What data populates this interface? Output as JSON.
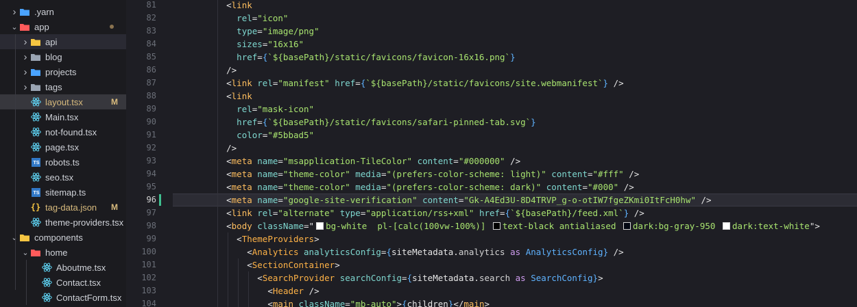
{
  "explorer": {
    "items": [
      {
        "label": ".yarn",
        "kind": "folder",
        "depth": 1,
        "expanded": false,
        "icon": "folder-yarn-icon",
        "color": "#4aa3ff"
      },
      {
        "label": "app",
        "kind": "folder",
        "depth": 1,
        "expanded": true,
        "icon": "folder-app-icon",
        "color": "#ff5b5b",
        "has_dot": true
      },
      {
        "label": "api",
        "kind": "folder",
        "depth": 2,
        "expanded": false,
        "icon": "folder-api-icon",
        "color": "#f5c542",
        "selected": true
      },
      {
        "label": "blog",
        "kind": "folder",
        "depth": 2,
        "expanded": false,
        "icon": "folder-icon",
        "color": "#9aa4b2"
      },
      {
        "label": "projects",
        "kind": "folder",
        "depth": 2,
        "expanded": false,
        "icon": "folder-projects-icon",
        "color": "#4aa3ff"
      },
      {
        "label": "tags",
        "kind": "folder",
        "depth": 2,
        "expanded": false,
        "icon": "folder-icon",
        "color": "#9aa4b2"
      },
      {
        "label": "layout.tsx",
        "kind": "file",
        "depth": 2,
        "icon": "react-icon",
        "color": "#61dafb",
        "active": true,
        "badge": "M"
      },
      {
        "label": "Main.tsx",
        "kind": "file",
        "depth": 2,
        "icon": "react-icon",
        "color": "#61dafb"
      },
      {
        "label": "not-found.tsx",
        "kind": "file",
        "depth": 2,
        "icon": "react-icon",
        "color": "#61dafb"
      },
      {
        "label": "page.tsx",
        "kind": "file",
        "depth": 2,
        "icon": "react-icon",
        "color": "#61dafb"
      },
      {
        "label": "robots.ts",
        "kind": "file",
        "depth": 2,
        "icon": "typescript-icon",
        "color": "#3178c6"
      },
      {
        "label": "seo.tsx",
        "kind": "file",
        "depth": 2,
        "icon": "react-icon",
        "color": "#61dafb"
      },
      {
        "label": "sitemap.ts",
        "kind": "file",
        "depth": 2,
        "icon": "typescript-icon",
        "color": "#3178c6"
      },
      {
        "label": "tag-data.json",
        "kind": "file",
        "depth": 2,
        "icon": "json-icon",
        "color": "#f5c542",
        "badge": "M"
      },
      {
        "label": "theme-providers.tsx",
        "kind": "file",
        "depth": 2,
        "icon": "react-icon",
        "color": "#61dafb"
      },
      {
        "label": "components",
        "kind": "folder",
        "depth": 1,
        "expanded": true,
        "icon": "folder-components-icon",
        "color": "#f5c542"
      },
      {
        "label": "home",
        "kind": "folder",
        "depth": 2,
        "expanded": true,
        "icon": "folder-home-icon",
        "color": "#ff5b5b"
      },
      {
        "label": "Aboutme.tsx",
        "kind": "file",
        "depth": 3,
        "icon": "react-icon",
        "color": "#61dafb"
      },
      {
        "label": "Contact.tsx",
        "kind": "file",
        "depth": 3,
        "icon": "react-icon",
        "color": "#61dafb"
      },
      {
        "label": "ContactForm.tsx",
        "kind": "file",
        "depth": 3,
        "icon": "react-icon",
        "color": "#61dafb"
      }
    ]
  },
  "editor": {
    "current_line": 96,
    "modified_line": 96,
    "lines": [
      {
        "n": "81",
        "indent": 4,
        "tokens": [
          [
            "t-punc",
            "<"
          ],
          [
            "t-tag",
            "link"
          ]
        ]
      },
      {
        "n": "82",
        "indent": 6,
        "tokens": [
          [
            "t-attr",
            "rel"
          ],
          [
            "t-punc",
            "="
          ],
          [
            "t-str",
            "\"icon\""
          ]
        ]
      },
      {
        "n": "83",
        "indent": 6,
        "tokens": [
          [
            "t-attr",
            "type"
          ],
          [
            "t-punc",
            "="
          ],
          [
            "t-str",
            "\"image/png\""
          ]
        ]
      },
      {
        "n": "84",
        "indent": 6,
        "tokens": [
          [
            "t-attr",
            "sizes"
          ],
          [
            "t-punc",
            "="
          ],
          [
            "t-str",
            "\"16x16\""
          ]
        ]
      },
      {
        "n": "85",
        "indent": 6,
        "tokens": [
          [
            "t-attr",
            "href"
          ],
          [
            "t-punc",
            "="
          ],
          [
            "t-br",
            "{"
          ],
          [
            "t-str",
            "`${basePath}/static/favicons/favicon-16x16.png`"
          ],
          [
            "t-br",
            "}"
          ]
        ]
      },
      {
        "n": "86",
        "indent": 4,
        "tokens": [
          [
            "t-punc",
            "/>"
          ]
        ]
      },
      {
        "n": "87",
        "indent": 4,
        "tokens": [
          [
            "t-punc",
            "<"
          ],
          [
            "t-tag",
            "link"
          ],
          [
            "t-plain",
            " "
          ],
          [
            "t-attr",
            "rel"
          ],
          [
            "t-punc",
            "="
          ],
          [
            "t-str",
            "\"manifest\""
          ],
          [
            "t-plain",
            " "
          ],
          [
            "t-attr",
            "href"
          ],
          [
            "t-punc",
            "="
          ],
          [
            "t-br",
            "{"
          ],
          [
            "t-str",
            "`${basePath}/static/favicons/site.webmanifest`"
          ],
          [
            "t-br",
            "}"
          ],
          [
            "t-plain",
            " "
          ],
          [
            "t-punc",
            "/>"
          ]
        ]
      },
      {
        "n": "88",
        "indent": 4,
        "tokens": [
          [
            "t-punc",
            "<"
          ],
          [
            "t-tag",
            "link"
          ]
        ]
      },
      {
        "n": "89",
        "indent": 6,
        "tokens": [
          [
            "t-attr",
            "rel"
          ],
          [
            "t-punc",
            "="
          ],
          [
            "t-str",
            "\"mask-icon\""
          ]
        ]
      },
      {
        "n": "90",
        "indent": 6,
        "tokens": [
          [
            "t-attr",
            "href"
          ],
          [
            "t-punc",
            "="
          ],
          [
            "t-br",
            "{"
          ],
          [
            "t-str",
            "`${basePath}/static/favicons/safari-pinned-tab.svg`"
          ],
          [
            "t-br",
            "}"
          ]
        ]
      },
      {
        "n": "91",
        "indent": 6,
        "tokens": [
          [
            "t-attr",
            "color"
          ],
          [
            "t-punc",
            "="
          ],
          [
            "t-str",
            "\"#5bbad5\""
          ]
        ]
      },
      {
        "n": "92",
        "indent": 4,
        "tokens": [
          [
            "t-punc",
            "/>"
          ]
        ]
      },
      {
        "n": "93",
        "indent": 4,
        "tokens": [
          [
            "t-punc",
            "<"
          ],
          [
            "t-tag",
            "meta"
          ],
          [
            "t-plain",
            " "
          ],
          [
            "t-attr",
            "name"
          ],
          [
            "t-punc",
            "="
          ],
          [
            "t-str",
            "\"msapplication-TileColor\""
          ],
          [
            "t-plain",
            " "
          ],
          [
            "t-attr",
            "content"
          ],
          [
            "t-punc",
            "="
          ],
          [
            "t-str",
            "\"#000000\""
          ],
          [
            "t-plain",
            " "
          ],
          [
            "t-punc",
            "/>"
          ]
        ]
      },
      {
        "n": "94",
        "indent": 4,
        "tokens": [
          [
            "t-punc",
            "<"
          ],
          [
            "t-tag",
            "meta"
          ],
          [
            "t-plain",
            " "
          ],
          [
            "t-attr",
            "name"
          ],
          [
            "t-punc",
            "="
          ],
          [
            "t-str",
            "\"theme-color\""
          ],
          [
            "t-plain",
            " "
          ],
          [
            "t-attr",
            "media"
          ],
          [
            "t-punc",
            "="
          ],
          [
            "t-str",
            "\"(prefers-color-scheme: light)\""
          ],
          [
            "t-plain",
            " "
          ],
          [
            "t-attr",
            "content"
          ],
          [
            "t-punc",
            "="
          ],
          [
            "t-str",
            "\"#fff\""
          ],
          [
            "t-plain",
            " "
          ],
          [
            "t-punc",
            "/>"
          ]
        ]
      },
      {
        "n": "95",
        "indent": 4,
        "tokens": [
          [
            "t-punc",
            "<"
          ],
          [
            "t-tag",
            "meta"
          ],
          [
            "t-plain",
            " "
          ],
          [
            "t-attr",
            "name"
          ],
          [
            "t-punc",
            "="
          ],
          [
            "t-str",
            "\"theme-color\""
          ],
          [
            "t-plain",
            " "
          ],
          [
            "t-attr",
            "media"
          ],
          [
            "t-punc",
            "="
          ],
          [
            "t-str",
            "\"(prefers-color-scheme: dark)\""
          ],
          [
            "t-plain",
            " "
          ],
          [
            "t-attr",
            "content"
          ],
          [
            "t-punc",
            "="
          ],
          [
            "t-str",
            "\"#000\""
          ],
          [
            "t-plain",
            " "
          ],
          [
            "t-punc",
            "/>"
          ]
        ]
      },
      {
        "n": "96",
        "indent": 4,
        "tokens": [
          [
            "t-punc",
            "<"
          ],
          [
            "t-tag",
            "meta"
          ],
          [
            "t-plain",
            " "
          ],
          [
            "t-attr",
            "name"
          ],
          [
            "t-punc",
            "="
          ],
          [
            "t-str",
            "\"google-site-verification\""
          ],
          [
            "t-plain",
            " "
          ],
          [
            "t-attr",
            "content"
          ],
          [
            "t-punc",
            "="
          ],
          [
            "t-str",
            "\"Gk-A4Ed3U-8D4TRVP_g-o-otIW7fgeZKmi0ItFcH0hw\""
          ],
          [
            "t-plain",
            " "
          ],
          [
            "t-punc",
            "/>"
          ]
        ]
      },
      {
        "n": "97",
        "indent": 4,
        "tokens": [
          [
            "t-punc",
            "<"
          ],
          [
            "t-tag",
            "link"
          ],
          [
            "t-plain",
            " "
          ],
          [
            "t-attr",
            "rel"
          ],
          [
            "t-punc",
            "="
          ],
          [
            "t-str",
            "\"alternate\""
          ],
          [
            "t-plain",
            " "
          ],
          [
            "t-attr",
            "type"
          ],
          [
            "t-punc",
            "="
          ],
          [
            "t-str",
            "\"application/rss+xml\""
          ],
          [
            "t-plain",
            " "
          ],
          [
            "t-attr",
            "href"
          ],
          [
            "t-punc",
            "="
          ],
          [
            "t-br",
            "{"
          ],
          [
            "t-str",
            "`${basePath}/feed.xml`"
          ],
          [
            "t-br",
            "}"
          ],
          [
            "t-plain",
            " "
          ],
          [
            "t-punc",
            "/>"
          ]
        ]
      },
      {
        "n": "98",
        "indent": 4,
        "tokens": [
          [
            "t-punc",
            "<"
          ],
          [
            "t-tag",
            "body"
          ],
          [
            "t-plain",
            " "
          ],
          [
            "t-attr",
            "className"
          ],
          [
            "t-punc",
            "=\""
          ],
          [
            "swatch",
            "#ffffff"
          ],
          [
            "t-str",
            "bg-white  pl-[calc(100vw-100%)] "
          ],
          [
            "swatch",
            "#000000"
          ],
          [
            "t-str",
            "text-black antialiased "
          ],
          [
            "swatch",
            "#030712"
          ],
          [
            "t-str",
            "dark:bg-gray-950 "
          ],
          [
            "swatch",
            "#ffffff"
          ],
          [
            "t-str",
            "dark:text-white"
          ],
          [
            "t-punc",
            "\">"
          ]
        ]
      },
      {
        "n": "99",
        "indent": 6,
        "tokens": [
          [
            "t-punc",
            "<"
          ],
          [
            "t-comp",
            "ThemeProviders"
          ],
          [
            "t-punc",
            ">"
          ]
        ]
      },
      {
        "n": "100",
        "indent": 8,
        "tokens": [
          [
            "t-punc",
            "<"
          ],
          [
            "t-comp",
            "Analytics"
          ],
          [
            "t-plain",
            " "
          ],
          [
            "t-attr",
            "analyticsConfig"
          ],
          [
            "t-punc",
            "="
          ],
          [
            "t-br",
            "{"
          ],
          [
            "t-var",
            "siteMetadata"
          ],
          [
            "t-punc",
            "."
          ],
          [
            "t-prop",
            "analytics"
          ],
          [
            "t-plain",
            " "
          ],
          [
            "t-kw",
            "as"
          ],
          [
            "t-plain",
            " "
          ],
          [
            "t-type",
            "AnalyticsConfig"
          ],
          [
            "t-br",
            "}"
          ],
          [
            "t-plain",
            " "
          ],
          [
            "t-punc",
            "/>"
          ]
        ]
      },
      {
        "n": "101",
        "indent": 8,
        "tokens": [
          [
            "t-punc",
            "<"
          ],
          [
            "t-comp",
            "SectionContainer"
          ],
          [
            "t-punc",
            ">"
          ]
        ]
      },
      {
        "n": "102",
        "indent": 10,
        "tokens": [
          [
            "t-punc",
            "<"
          ],
          [
            "t-comp",
            "SearchProvider"
          ],
          [
            "t-plain",
            " "
          ],
          [
            "t-attr",
            "searchConfig"
          ],
          [
            "t-punc",
            "="
          ],
          [
            "t-br",
            "{"
          ],
          [
            "t-var",
            "siteMetadata"
          ],
          [
            "t-punc",
            "."
          ],
          [
            "t-prop",
            "search"
          ],
          [
            "t-plain",
            " "
          ],
          [
            "t-kw",
            "as"
          ],
          [
            "t-plain",
            " "
          ],
          [
            "t-type",
            "SearchConfig"
          ],
          [
            "t-br",
            "}"
          ],
          [
            "t-punc",
            ">"
          ]
        ]
      },
      {
        "n": "103",
        "indent": 12,
        "tokens": [
          [
            "t-punc",
            "<"
          ],
          [
            "t-comp",
            "Header"
          ],
          [
            "t-plain",
            " "
          ],
          [
            "t-punc",
            "/>"
          ]
        ]
      },
      {
        "n": "104",
        "indent": 12,
        "tokens": [
          [
            "t-punc",
            "<"
          ],
          [
            "t-tag",
            "main"
          ],
          [
            "t-plain",
            " "
          ],
          [
            "t-attr",
            "className"
          ],
          [
            "t-punc",
            "="
          ],
          [
            "t-str",
            "\"mb-auto\""
          ],
          [
            "t-punc",
            ">"
          ],
          [
            "t-br",
            "{"
          ],
          [
            "t-var",
            "children"
          ],
          [
            "t-br",
            "}"
          ],
          [
            "t-punc",
            "</"
          ],
          [
            "t-tag",
            "main"
          ],
          [
            "t-punc",
            ">"
          ]
        ]
      }
    ]
  }
}
